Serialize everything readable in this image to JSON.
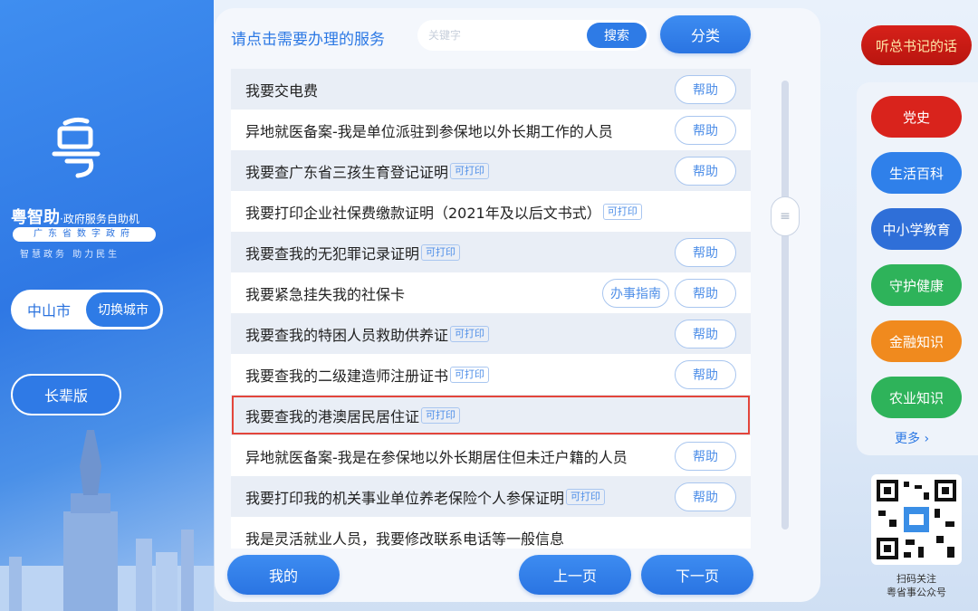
{
  "brand": {
    "name": "粤智助",
    "subtitle": "·政府服务自助机",
    "province_bar": "广东省数字政府",
    "slogan": "智慧政务 助力民生"
  },
  "city": {
    "name": "中山市",
    "switch_label": "切换城市"
  },
  "elder_mode_label": "长辈版",
  "header": {
    "prompt": "请点击需要办理的服务",
    "search_placeholder": "关键字",
    "search_label": "搜索",
    "category_label": "分类"
  },
  "services": [
    {
      "title": "我要交电费",
      "tag": "",
      "guide": "",
      "help": "帮助"
    },
    {
      "title": "异地就医备案-我是单位派驻到参保地以外长期工作的人员",
      "tag": "",
      "guide": "",
      "help": "帮助"
    },
    {
      "title": "我要查广东省三孩生育登记证明",
      "tag": "可打印",
      "guide": "",
      "help": "帮助"
    },
    {
      "title": "我要打印企业社保费缴款证明（2021年及以后文书式）",
      "tag": "可打印",
      "guide": "",
      "help": ""
    },
    {
      "title": "我要查我的无犯罪记录证明",
      "tag": "可打印",
      "guide": "",
      "help": "帮助"
    },
    {
      "title": "我要紧急挂失我的社保卡",
      "tag": "",
      "guide": "办事指南",
      "help": "帮助"
    },
    {
      "title": "我要查我的特困人员救助供养证",
      "tag": "可打印",
      "guide": "",
      "help": "帮助"
    },
    {
      "title": "我要查我的二级建造师注册证书",
      "tag": "可打印",
      "guide": "",
      "help": "帮助"
    },
    {
      "title": "我要查我的港澳居民居住证",
      "tag": "可打印",
      "guide": "",
      "help": "",
      "selected": true
    },
    {
      "title": "异地就医备案-我是在参保地以外长期居住但未迁户籍的人员",
      "tag": "",
      "guide": "",
      "help": "帮助"
    },
    {
      "title": "我要打印我的机关事业单位养老保险个人参保证明",
      "tag": "可打印",
      "guide": "",
      "help": "帮助"
    },
    {
      "title": "我是灵活就业人员，我要修改联系电话等一般信息",
      "tag": "",
      "guide": "",
      "help": ""
    }
  ],
  "footer": {
    "mine_label": "我的",
    "prev_label": "上一页",
    "next_label": "下一页"
  },
  "listen_label": "听总书记的话",
  "side_menu": [
    {
      "label": "党史",
      "color": "#d9231c"
    },
    {
      "label": "生活百科",
      "color": "#2f80ea"
    },
    {
      "label": "中小学教育",
      "color": "#2f6fd8"
    },
    {
      "label": "守护健康",
      "color": "#2eb35a"
    },
    {
      "label": "金融知识",
      "color": "#f08a1e"
    },
    {
      "label": "农业知识",
      "color": "#2eb35a"
    }
  ],
  "more_label": "更多 ›",
  "qr_caption_1": "扫码关注",
  "qr_caption_2": "粤省事公众号"
}
